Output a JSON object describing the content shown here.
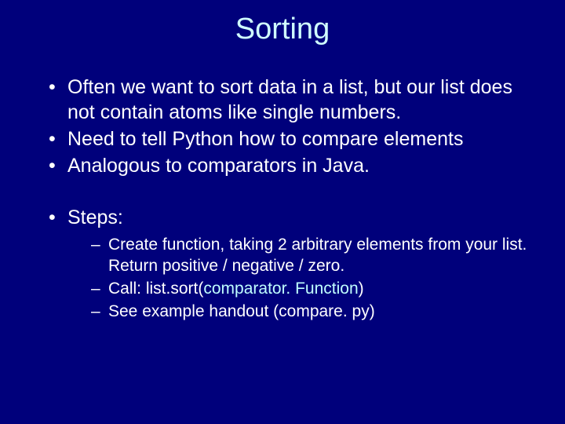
{
  "title": "Sorting",
  "bullets": {
    "b1": "Often we want to sort data in a list, but our list does not contain atoms like single numbers.",
    "b2": "Need to tell Python how to compare elements",
    "b3": "Analogous to comparators in Java.",
    "b4": "Steps:"
  },
  "sub": {
    "s1": "Create function, taking 2 arbitrary elements from your list.  Return positive  /  negative  /  zero.",
    "s2a": "Call:      list.sort(",
    "s2b": "comparator. Function",
    "s2c": ")",
    "s3": "See example handout (compare. py)"
  }
}
